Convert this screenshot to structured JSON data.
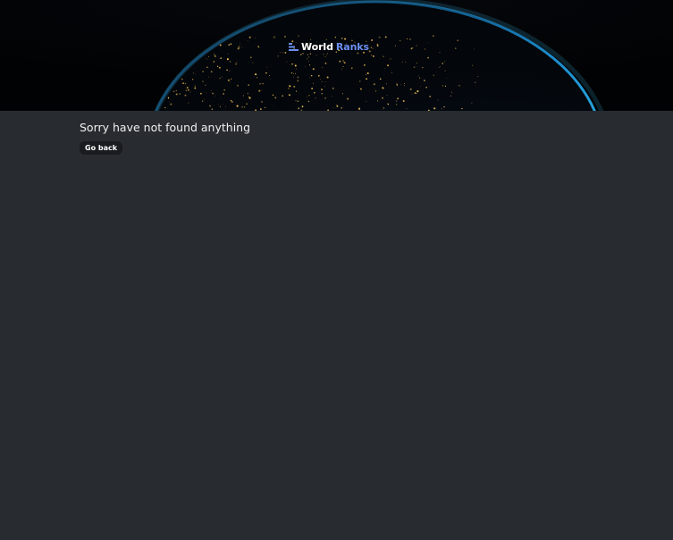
{
  "header": {
    "logo_word1": "World",
    "logo_word2": "Ranks",
    "logo_icon": "ranking-bars-icon",
    "brand_color": "#6c8fef"
  },
  "main": {
    "message": "Sorry have not found anything",
    "back_button_label": "Go back"
  }
}
